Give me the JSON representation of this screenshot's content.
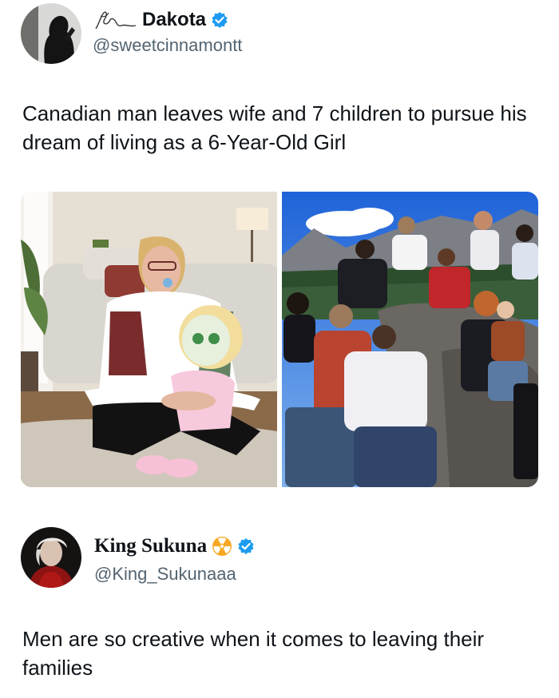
{
  "tweet1": {
    "display_name": "Dakota",
    "handle": "@sweetcinnamontt",
    "text": "Canadian man leaves wife and 7 children to pursue his dream of living as a 6-Year-Old Girl",
    "icons": [
      "avatar",
      "signature-icon",
      "verified-icon"
    ],
    "media": [
      "photo-left-living-room",
      "photo-right-family-mountains"
    ]
  },
  "tweet2": {
    "display_name": "King Sukuna",
    "handle": "@King_Sukunaaa",
    "text": "Men are so creative when it comes to leaving their families",
    "icons": [
      "avatar",
      "radioactive-icon",
      "verified-icon"
    ]
  },
  "colors": {
    "text": "#0f1419",
    "secondary": "#536471",
    "verified": "#1d9bf0",
    "radioactive": "#f7a823"
  }
}
